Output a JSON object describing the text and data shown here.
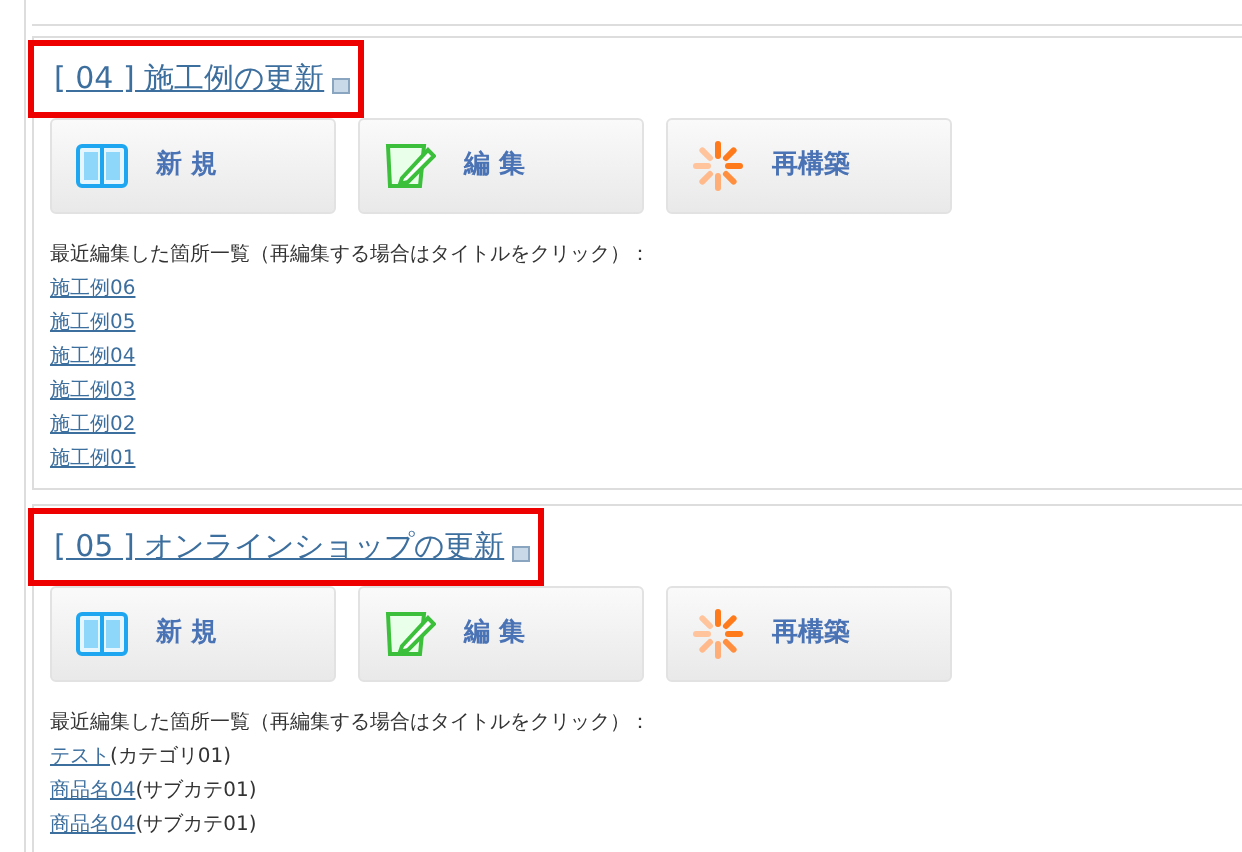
{
  "sections": [
    {
      "number": "[ 04 ]",
      "title": "施工例の更新",
      "highlighted": true,
      "buttons": [
        {
          "kind": "new",
          "label": "新 規"
        },
        {
          "kind": "edit",
          "label": "編 集"
        },
        {
          "kind": "rebuild",
          "label": "再構築"
        }
      ],
      "recent_label": "最近編集した箇所一覧（再編集する場合はタイトルをクリック）：",
      "recent": [
        {
          "link": "施工例06"
        },
        {
          "link": "施工例05"
        },
        {
          "link": "施工例04"
        },
        {
          "link": "施工例03"
        },
        {
          "link": "施工例02"
        },
        {
          "link": "施工例01"
        }
      ]
    },
    {
      "number": "[ 05 ]",
      "title": "オンラインショップの更新",
      "highlighted": true,
      "buttons": [
        {
          "kind": "new",
          "label": "新 規"
        },
        {
          "kind": "edit",
          "label": "編 集"
        },
        {
          "kind": "rebuild",
          "label": "再構築"
        }
      ],
      "recent_label": "最近編集した箇所一覧（再編集する場合はタイトルをクリック）：",
      "recent": [
        {
          "link": "テスト",
          "suffix": "(カテゴリ01)"
        },
        {
          "link": "商品名04",
          "suffix": "(サブカテ01)"
        },
        {
          "link": "商品名04",
          "suffix": "(サブカテ01)"
        }
      ]
    }
  ]
}
